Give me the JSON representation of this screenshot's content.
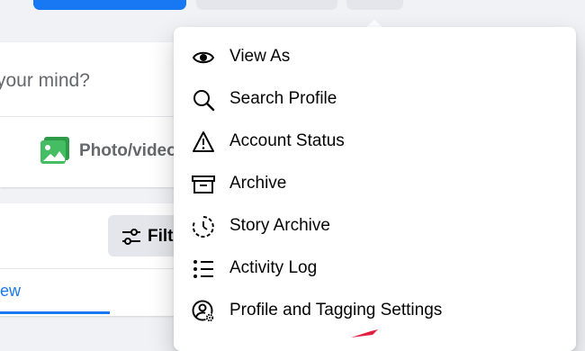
{
  "composer": {
    "placeholder": "your mind?",
    "photo_label": "Photo/video"
  },
  "posts": {
    "filters_label": "Filters",
    "tab_label": "ew"
  },
  "menu": {
    "items": [
      {
        "label": "View As",
        "icon": "eye-icon"
      },
      {
        "label": "Search Profile",
        "icon": "search-icon"
      },
      {
        "label": "Account Status",
        "icon": "warning-icon"
      },
      {
        "label": "Archive",
        "icon": "archive-box-icon"
      },
      {
        "label": "Story Archive",
        "icon": "story-archive-icon"
      },
      {
        "label": "Activity Log",
        "icon": "list-icon"
      },
      {
        "label": "Profile and Tagging Settings",
        "icon": "profile-settings-icon"
      }
    ]
  },
  "colors": {
    "brand_blue": "#1877f2",
    "background": "#f0f2f5",
    "secondary_button": "#e4e6eb",
    "text_secondary": "#65676b",
    "photo_green": "#45bd62",
    "arrow_red": "#e41e3f"
  }
}
